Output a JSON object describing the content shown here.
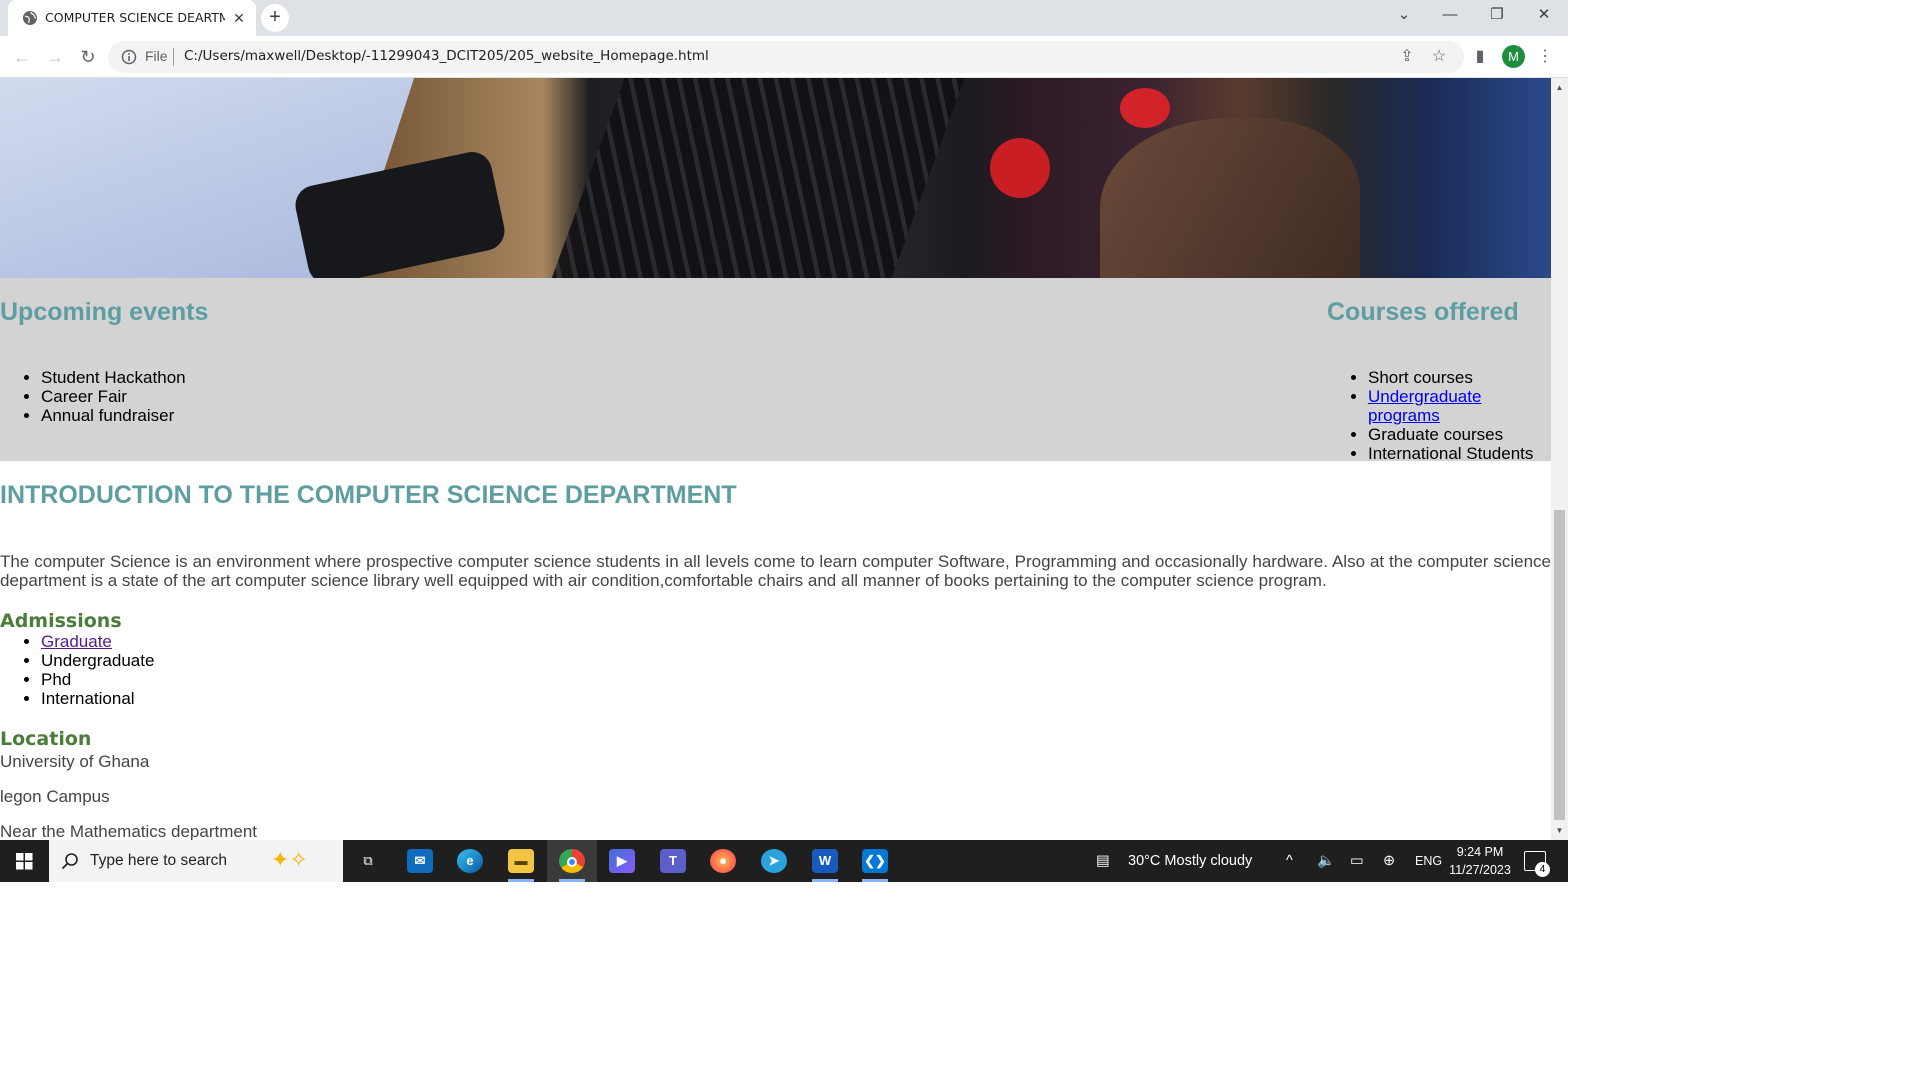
{
  "browser": {
    "tab_title": "COMPUTER SCIENCE DEARTMEN",
    "address_scheme": "File",
    "address_url": "C:/Users/maxwell/Desktop/-11299043_DCIT205/205_website_Homepage.html",
    "profile_initial": "M"
  },
  "page": {
    "events": {
      "title": "Upcoming events",
      "items": [
        "Student Hackathon",
        "Career Fair",
        "Annual fundraiser"
      ]
    },
    "courses": {
      "title": "Courses offered",
      "items": [
        "Short courses",
        "Undergraduate programs",
        "Graduate courses",
        "International Students"
      ]
    },
    "intro": {
      "title": "INTRODUCTION TO THE COMPUTER SCIENCE DEPARTMENT",
      "text": "The computer Science is an environment where prospective computer science students in all levels come to learn computer Software, Programming and occasionally hardware. Also at the computer science department is a state of the art computer science library well equipped with air condition,comfortable chairs and all manner of books pertaining to the computer science program."
    },
    "admissions": {
      "title": "Admissions",
      "items": [
        "Graduate",
        "Undergraduate",
        "Phd",
        "International"
      ]
    },
    "location": {
      "title": "Location",
      "lines": [
        "University of Ghana",
        "legon Campus",
        "Near the Mathematics department"
      ]
    }
  },
  "taskbar": {
    "search_placeholder": "Type here to search",
    "weather": "30°C  Mostly cloudy",
    "language": "ENG",
    "time": "9:24 PM",
    "date": "11/27/2023",
    "notification_count": "4"
  },
  "colors": {
    "heading_teal": "#5f9ea0",
    "heading_green": "#4a7c3a",
    "band_grey": "#d3d3d3",
    "link_blue": "#0000ee",
    "link_visited": "#551a8b"
  }
}
